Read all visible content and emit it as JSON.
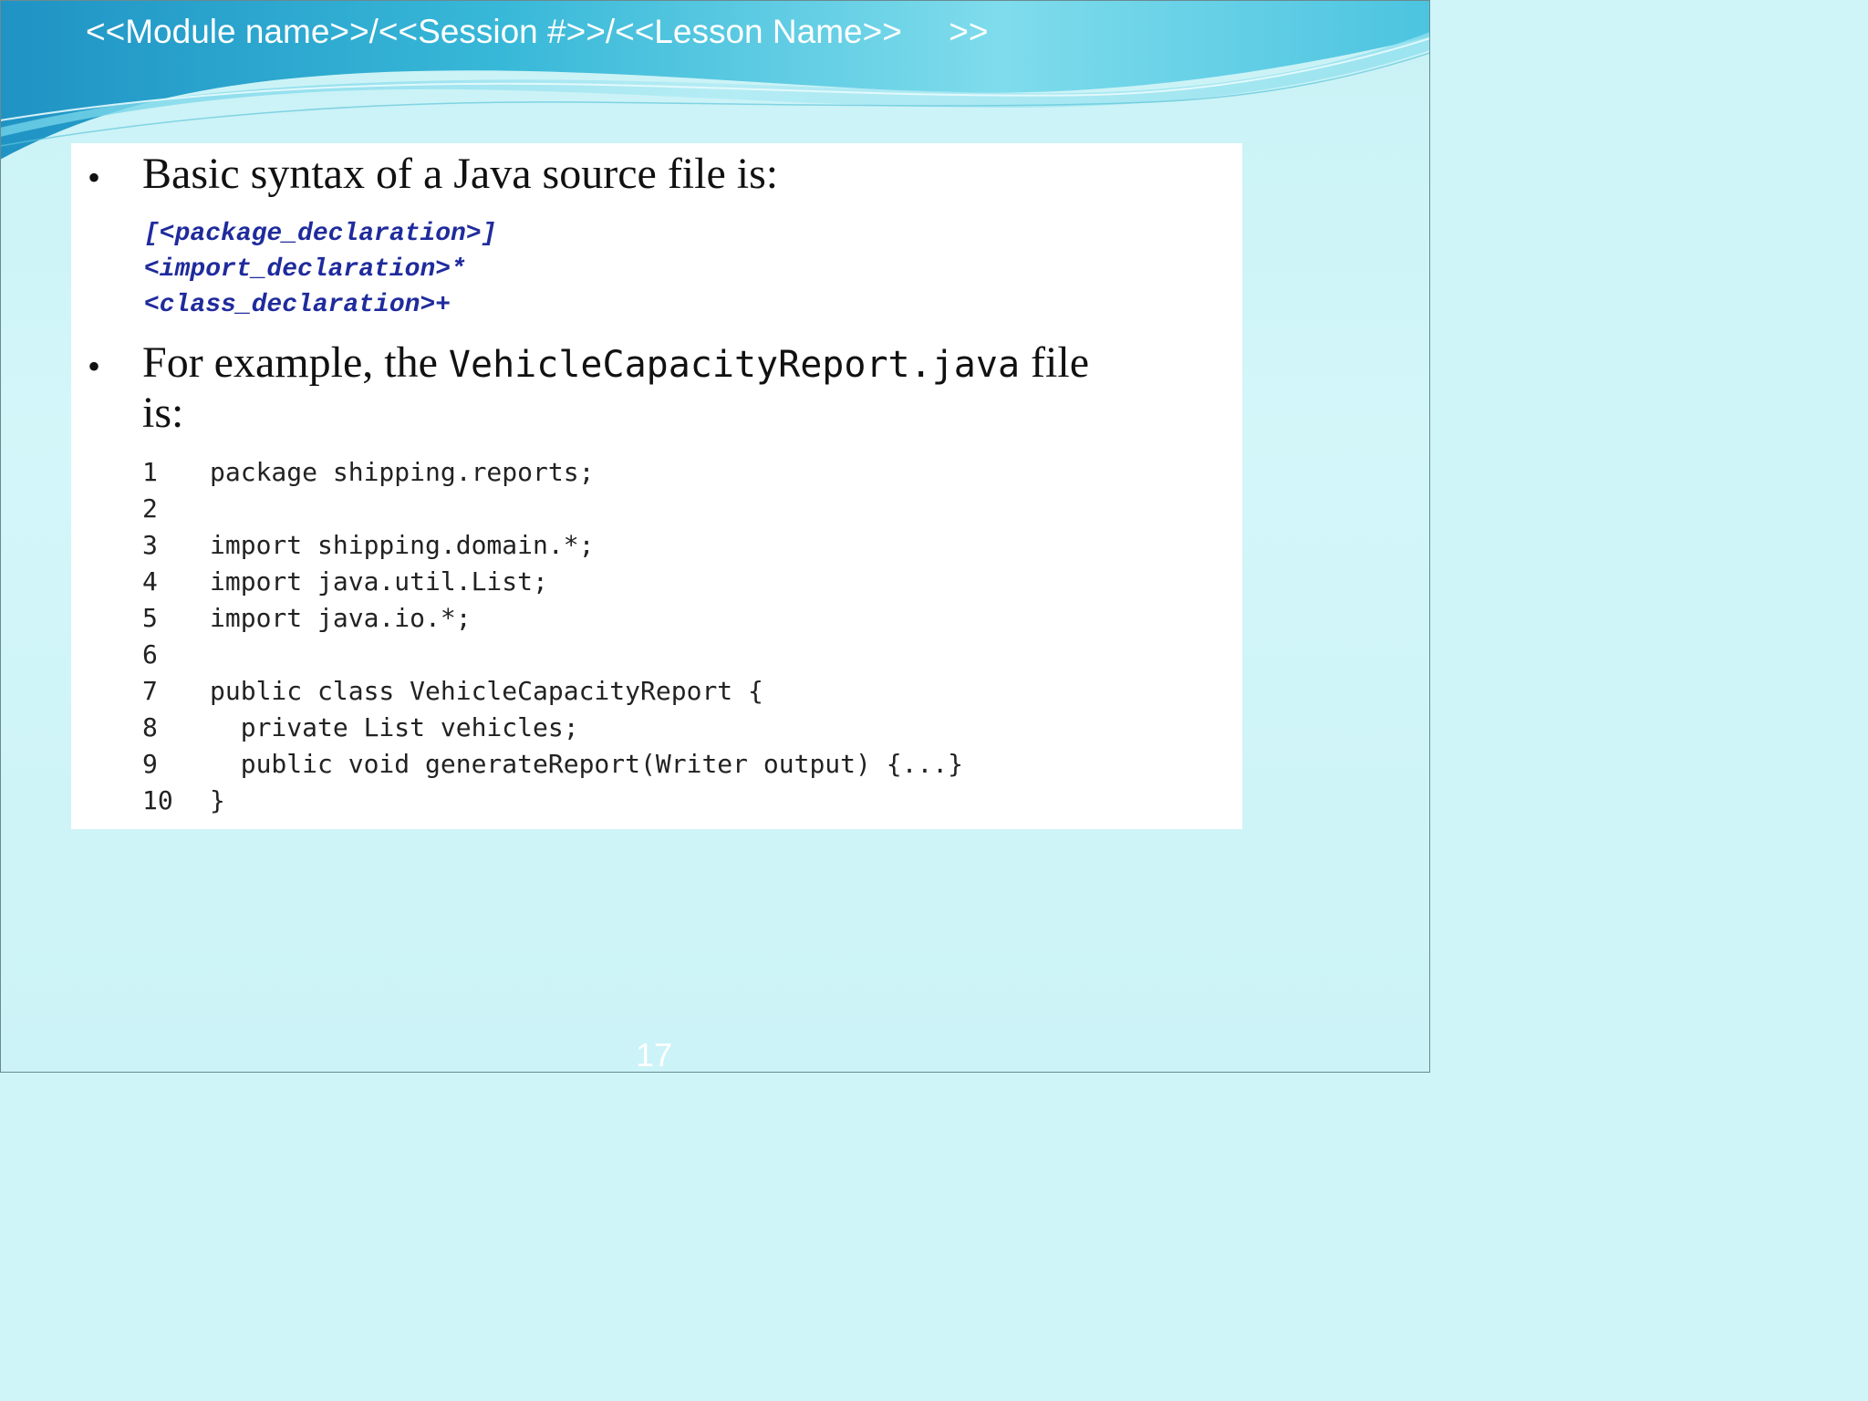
{
  "header": {
    "breadcrumb": "<<Module name>>/<<Session #>>/<<Lesson Name>>     >>"
  },
  "content": {
    "bullet1": {
      "text": "Basic syntax of a Java source file is:"
    },
    "syntax_lines": [
      "[<package_declaration>]",
      "<import_declaration>*",
      "<class_declaration>+"
    ],
    "bullet2": {
      "text_before": "For example, the ",
      "code": "VehicleCapacityReport.java",
      "text_after": " file",
      "text_line2": "is:"
    },
    "code_lines": [
      {
        "num": "1",
        "code": "package shipping.reports;"
      },
      {
        "num": "2",
        "code": ""
      },
      {
        "num": "3",
        "code": "import shipping.domain.*;"
      },
      {
        "num": "4",
        "code": "import java.util.List;"
      },
      {
        "num": "5",
        "code": "import java.io.*;"
      },
      {
        "num": "6",
        "code": ""
      },
      {
        "num": "7",
        "code": "public class VehicleCapacityReport {"
      },
      {
        "num": "8",
        "code": "  private List vehicles;"
      },
      {
        "num": "9",
        "code": "  public void generateReport(Writer output) {...}"
      },
      {
        "num": "10",
        "code": "}"
      }
    ]
  },
  "footer": {
    "page_number": "17"
  },
  "colors": {
    "background": "#cff5f8",
    "syntax_blue": "#1f2b9c",
    "header_text": "#ffffff"
  }
}
